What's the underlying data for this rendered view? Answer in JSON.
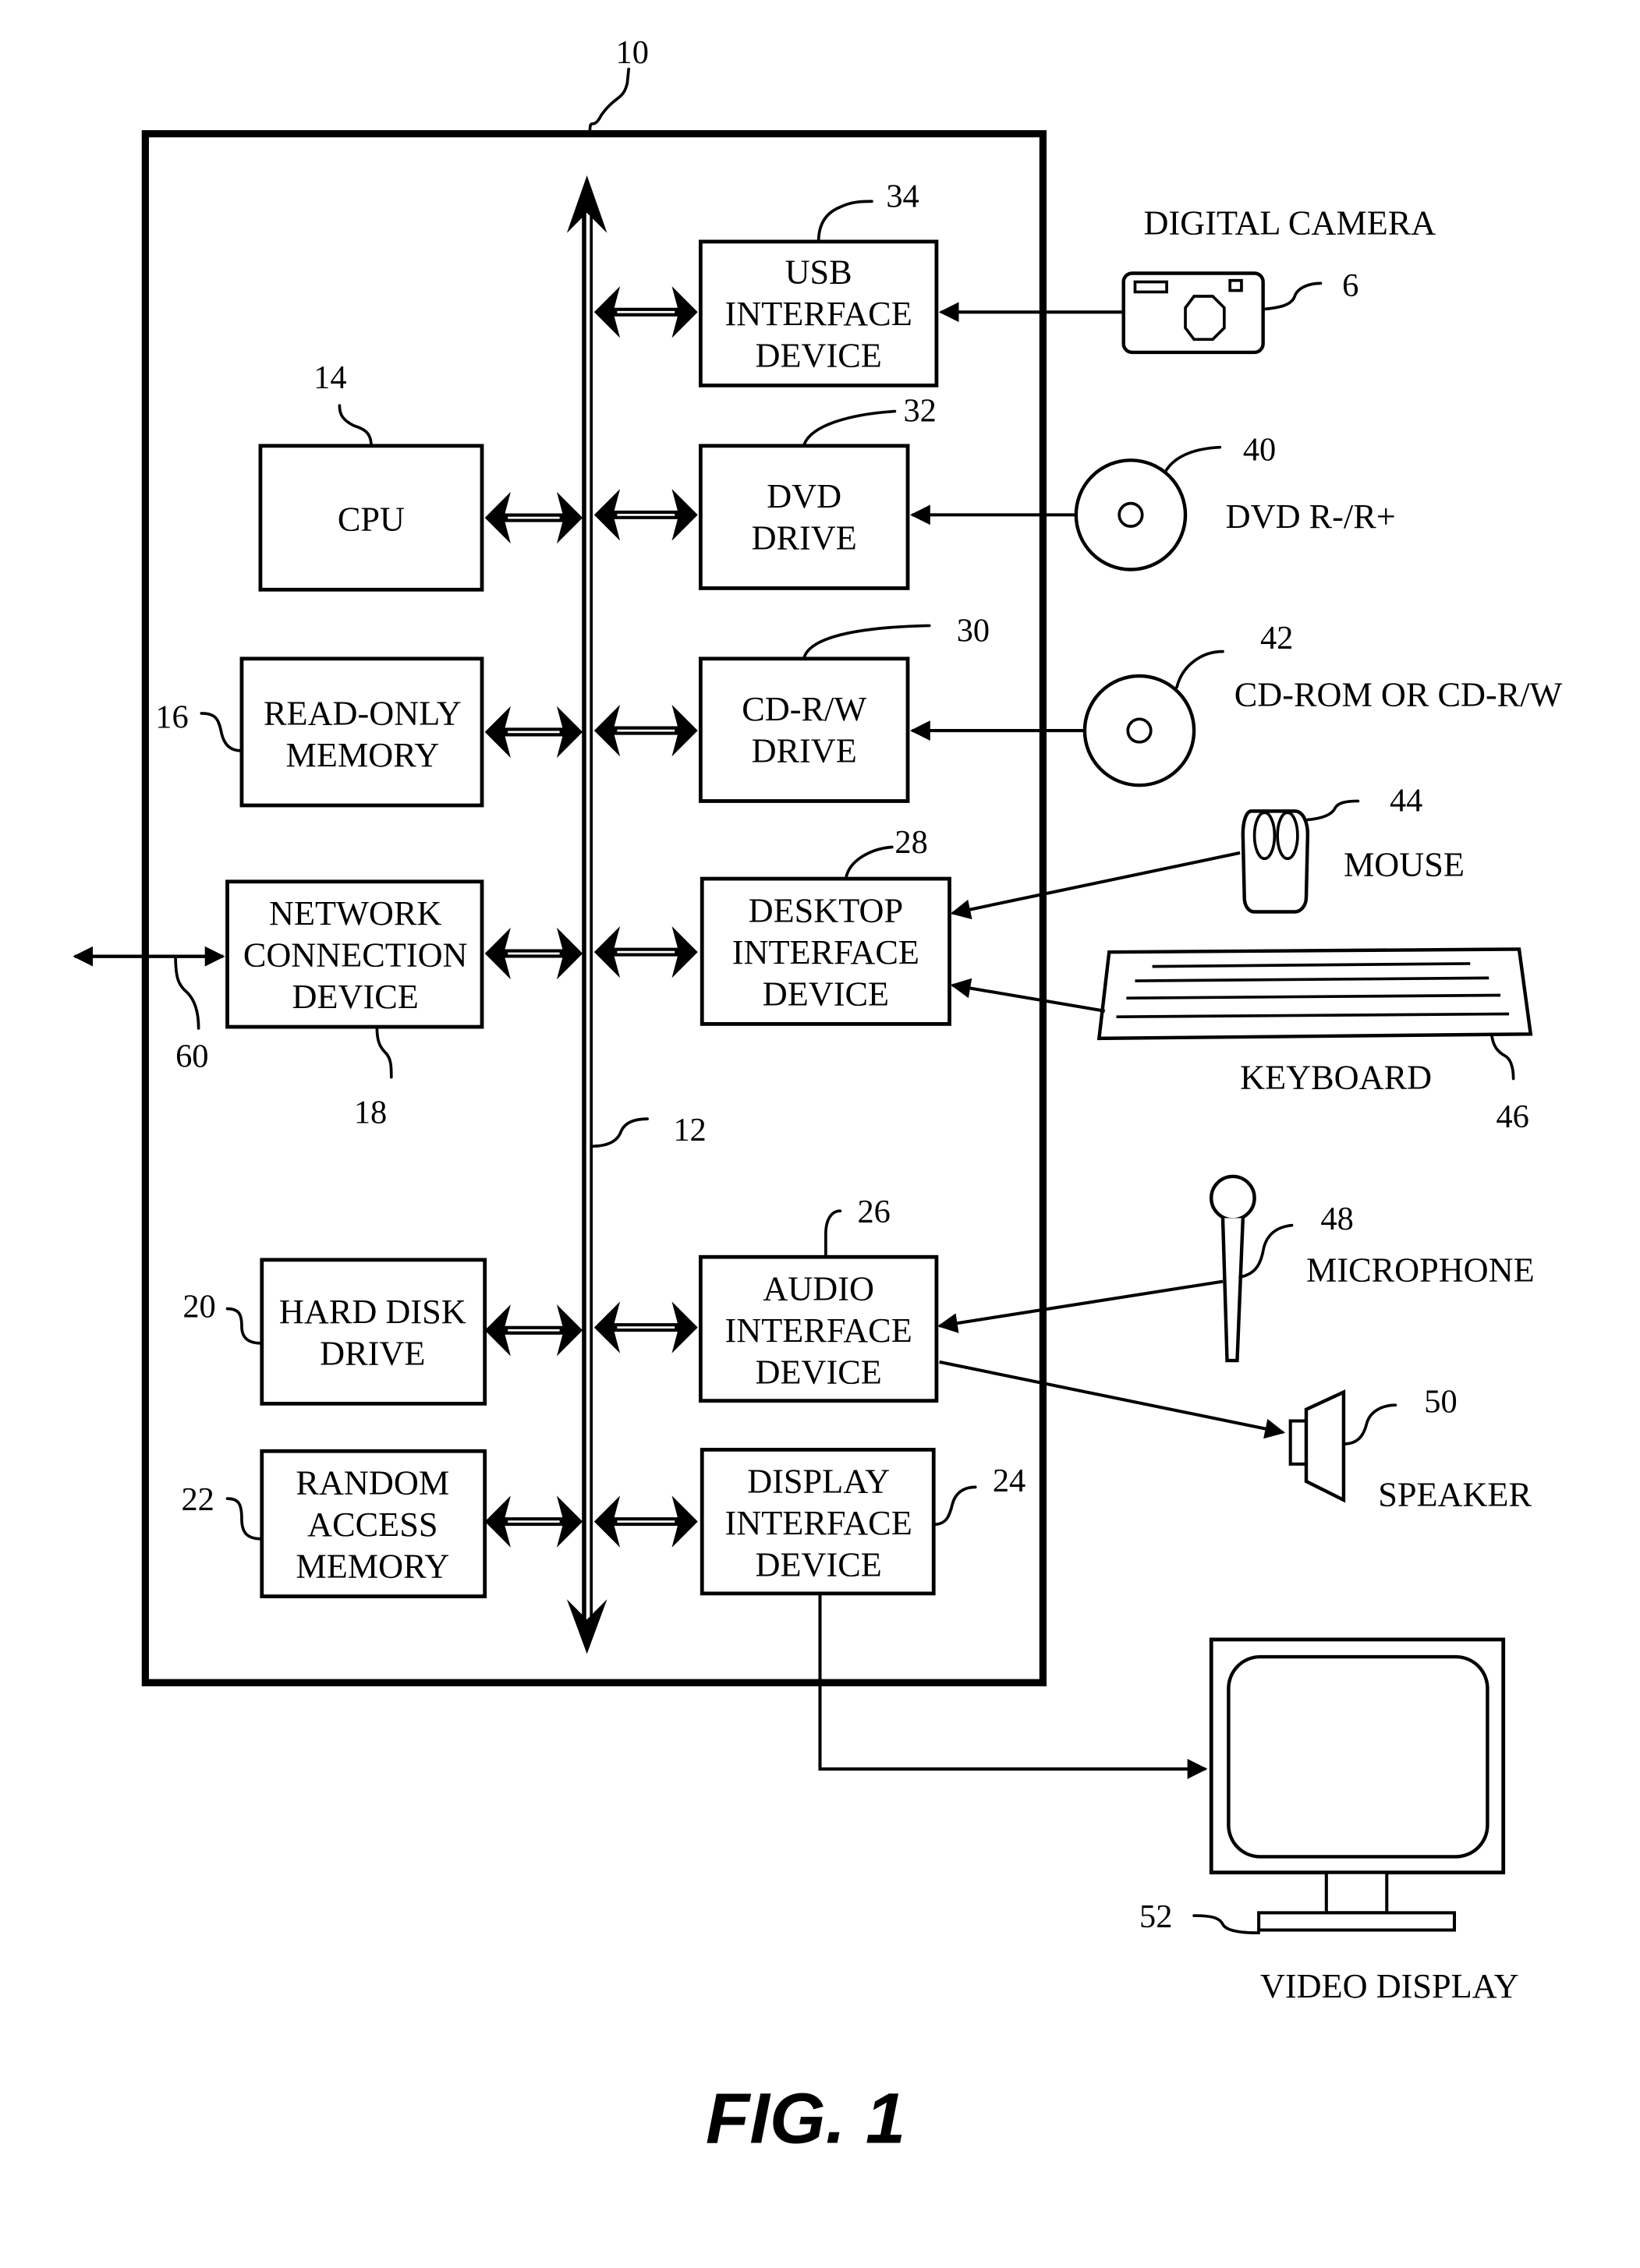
{
  "figure_label": "FIG. 1",
  "system": {
    "ref": "10"
  },
  "bus": {
    "ref": "12"
  },
  "internal_components": [
    {
      "id": "cpu",
      "ref": "14",
      "lines": [
        "CPU"
      ]
    },
    {
      "id": "rom",
      "ref": "16",
      "lines": [
        "READ-ONLY",
        "MEMORY"
      ]
    },
    {
      "id": "network",
      "ref": "18",
      "lines": [
        "NETWORK",
        "CONNECTION",
        "DEVICE"
      ]
    },
    {
      "id": "hdd",
      "ref": "20",
      "lines": [
        "HARD DISK",
        "DRIVE"
      ]
    },
    {
      "id": "ram",
      "ref": "22",
      "lines": [
        "RANDOM",
        "ACCESS",
        "MEMORY"
      ]
    },
    {
      "id": "display_if",
      "ref": "24",
      "lines": [
        "DISPLAY",
        "INTERFACE",
        "DEVICE"
      ]
    },
    {
      "id": "audio_if",
      "ref": "26",
      "lines": [
        "AUDIO",
        "INTERFACE",
        "DEVICE"
      ]
    },
    {
      "id": "desktop_if",
      "ref": "28",
      "lines": [
        "DESKTOP",
        "INTERFACE",
        "DEVICE"
      ]
    },
    {
      "id": "cdrw",
      "ref": "30",
      "lines": [
        "CD-R/W",
        "DRIVE"
      ]
    },
    {
      "id": "dvd",
      "ref": "32",
      "lines": [
        "DVD",
        "DRIVE"
      ]
    },
    {
      "id": "usb_if",
      "ref": "34",
      "lines": [
        "USB",
        "INTERFACE",
        "DEVICE"
      ]
    }
  ],
  "external_devices": [
    {
      "id": "camera",
      "ref": "6",
      "label": "DIGITAL CAMERA"
    },
    {
      "id": "dvd_disc",
      "ref": "40",
      "label": "DVD R-/R+"
    },
    {
      "id": "cd_disc",
      "ref": "42",
      "label": "CD-ROM OR CD-R/W"
    },
    {
      "id": "mouse",
      "ref": "44",
      "label": "MOUSE"
    },
    {
      "id": "keyboard",
      "ref": "46",
      "label": "KEYBOARD"
    },
    {
      "id": "microphone",
      "ref": "48",
      "label": "MICROPHONE"
    },
    {
      "id": "speaker",
      "ref": "50",
      "label": "SPEAKER"
    },
    {
      "id": "video_display",
      "ref": "52",
      "label": "VIDEO DISPLAY"
    }
  ],
  "network_link": {
    "ref": "60"
  }
}
